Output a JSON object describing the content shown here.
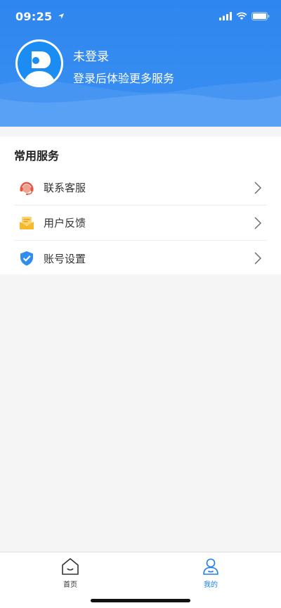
{
  "status_bar": {
    "time": "09:25"
  },
  "profile": {
    "title": "未登录",
    "subtitle": "登录后体验更多服务"
  },
  "services": {
    "title": "常用服务",
    "items": [
      {
        "label": "联系客服",
        "icon": "headset-icon"
      },
      {
        "label": "用户反馈",
        "icon": "feedback-mail-icon"
      },
      {
        "label": "账号设置",
        "icon": "shield-check-icon"
      }
    ]
  },
  "tabbar": {
    "tabs": [
      {
        "label": "首页",
        "icon": "home-icon",
        "active": false
      },
      {
        "label": "我的",
        "icon": "user-icon",
        "active": true
      }
    ]
  },
  "colors": {
    "header": "#2e86ef",
    "tab_active": "#1a7ff0",
    "tab_inactive": "#333333"
  }
}
